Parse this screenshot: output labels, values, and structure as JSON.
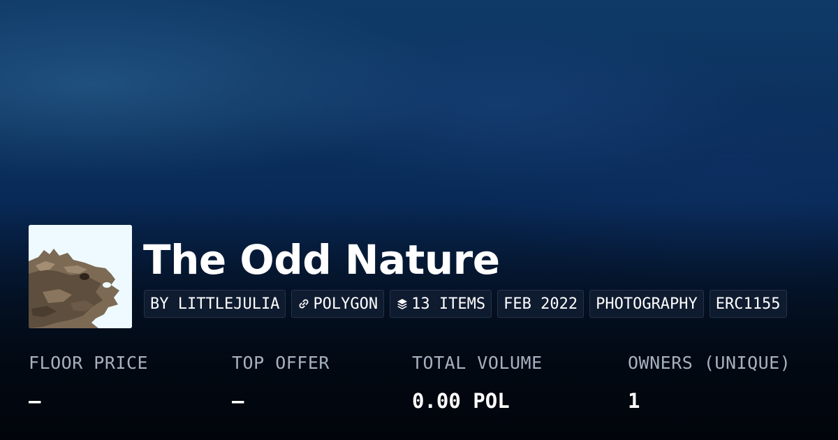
{
  "collection": {
    "title": "The Odd Nature",
    "avatar_icon": "rock-formation-photo",
    "tags": [
      {
        "label": "BY LITTLEJULIA",
        "icon": ""
      },
      {
        "label": "POLYGON",
        "icon": "link-icon"
      },
      {
        "label": "13 ITEMS",
        "icon": "layers-icon"
      },
      {
        "label": "FEB 2022",
        "icon": ""
      },
      {
        "label": "PHOTOGRAPHY",
        "icon": ""
      },
      {
        "label": "ERC1155",
        "icon": ""
      }
    ]
  },
  "stats": [
    {
      "label": "FLOOR PRICE",
      "value": "–"
    },
    {
      "label": "TOP OFFER",
      "value": "–"
    },
    {
      "label": "TOTAL VOLUME",
      "value": "0.00 POL"
    },
    {
      "label": "OWNERS (UNIQUE)",
      "value": "1"
    }
  ],
  "colors": {
    "background_top": "#0f3a68",
    "background_bottom": "#020812",
    "text_primary": "#ffffff",
    "text_muted": "#a7b1bf"
  }
}
